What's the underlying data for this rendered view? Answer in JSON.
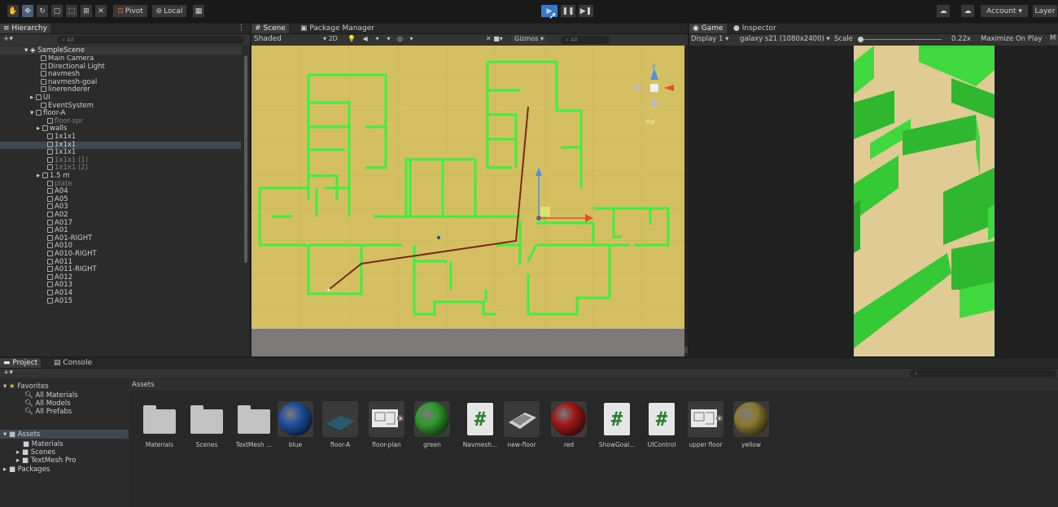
{
  "toolbar": {
    "pivot_label": "Pivot",
    "local_label": "Local",
    "account_label": "Account",
    "layers_label": "Layer"
  },
  "hierarchy": {
    "tab_label": "Hierarchy",
    "search_placeholder": "All",
    "scene_name": "SampleScene",
    "items": [
      {
        "label": "Main Camera",
        "dim": false
      },
      {
        "label": "Directional Light",
        "dim": false
      },
      {
        "label": "navmesh",
        "dim": false
      },
      {
        "label": "navmesh-goal",
        "dim": false
      },
      {
        "label": "linerenderer",
        "dim": false
      },
      {
        "label": "UI",
        "dim": false
      },
      {
        "label": "EventSystem",
        "dim": false
      },
      {
        "label": "floor-A",
        "dim": false
      },
      {
        "label": "floor-spr",
        "dim": true
      },
      {
        "label": "walls",
        "dim": false
      },
      {
        "label": "1x1x1",
        "dim": false
      },
      {
        "label": "1x1x1",
        "dim": false
      },
      {
        "label": "1x1x1",
        "dim": false
      },
      {
        "label": "1x1x1 (1)",
        "dim": true
      },
      {
        "label": "1x1x1 (2)",
        "dim": true
      },
      {
        "label": "1.5 m",
        "dim": false
      },
      {
        "label": "plate",
        "dim": true
      },
      {
        "label": "A04",
        "dim": false
      },
      {
        "label": "A05",
        "dim": false
      },
      {
        "label": "A03",
        "dim": false
      },
      {
        "label": "A02",
        "dim": false
      },
      {
        "label": "A017",
        "dim": false
      },
      {
        "label": "A01",
        "dim": false
      },
      {
        "label": "A01-RIGHT",
        "dim": false
      },
      {
        "label": "A010",
        "dim": false
      },
      {
        "label": "A010-RIGHT",
        "dim": false
      },
      {
        "label": "A011",
        "dim": false
      },
      {
        "label": "A011-RIGHT",
        "dim": false
      },
      {
        "label": "A012",
        "dim": false
      },
      {
        "label": "A013",
        "dim": false
      },
      {
        "label": "A014",
        "dim": false
      },
      {
        "label": "A015",
        "dim": false
      }
    ]
  },
  "scene": {
    "tab_scene": "Scene",
    "tab_package": "Package Manager",
    "shading": "Shaded",
    "mode_2d": "2D",
    "gizmos": "Gizmos",
    "search_placeholder": "All",
    "persp_label": "Top"
  },
  "game": {
    "tab_game": "Game",
    "tab_inspector": "Inspector",
    "display": "Display 1",
    "resolution": "galaxy s21 (1080x2400)",
    "scale_label": "Scale",
    "scale_value": "0.22x",
    "maximize": "Maximize On Play",
    "maximize_cut": "M"
  },
  "project": {
    "tab_project": "Project",
    "tab_console": "Console",
    "favorites_label": "Favorites",
    "favorites": [
      "All Materials",
      "All Models",
      "All Prefabs"
    ],
    "assets_label": "Assets",
    "tree": [
      "Materials",
      "Scenes",
      "TextMesh Pro"
    ],
    "packages_label": "Packages",
    "breadcrumb": "Assets",
    "assets": [
      {
        "label": "Materials",
        "kind": "folder"
      },
      {
        "label": "Scenes",
        "kind": "folder"
      },
      {
        "label": "TextMesh ...",
        "kind": "folder"
      },
      {
        "label": "blue",
        "kind": "sphere",
        "color": "#1f4e9c"
      },
      {
        "label": "floor-A",
        "kind": "mesh"
      },
      {
        "label": "floor-plan",
        "kind": "plan"
      },
      {
        "label": "green",
        "kind": "sphere",
        "color": "#2e9a2a"
      },
      {
        "label": "Navmesh...",
        "kind": "script"
      },
      {
        "label": "new-floor",
        "kind": "mesh2"
      },
      {
        "label": "red",
        "kind": "sphere",
        "color": "#a01818"
      },
      {
        "label": "ShowGoal...",
        "kind": "script"
      },
      {
        "label": "UIControl",
        "kind": "script"
      },
      {
        "label": "upper floor",
        "kind": "plan"
      },
      {
        "label": "yellow",
        "kind": "sphere",
        "color": "#8a7a30"
      }
    ]
  }
}
